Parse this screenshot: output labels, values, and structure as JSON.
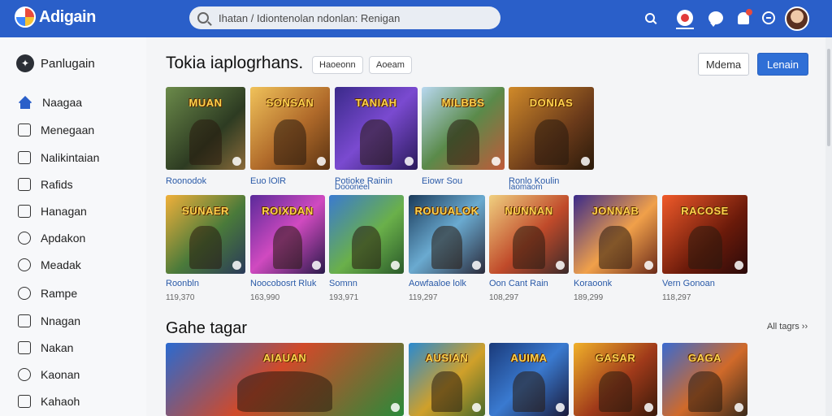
{
  "app": {
    "name": "Adigain"
  },
  "search": {
    "placeholder": "Ihatan / Idiontenolan ndonlan: Renigan"
  },
  "colors": {
    "topbar": "#2a5fc9",
    "accent": "#2f6fd6"
  },
  "topbar_icons": [
    "search-icon",
    "record-icon",
    "chat-icon",
    "notification-bell-icon",
    "apps-icon"
  ],
  "sidebar": {
    "header": "Panlugain",
    "items": [
      {
        "label": "Naagaa",
        "icon": "home-icon"
      },
      {
        "label": "Menegaan",
        "icon": "library-icon"
      },
      {
        "label": "Nalikintaian",
        "icon": "bookmark-icon"
      },
      {
        "label": "Rafids",
        "icon": "document-icon"
      },
      {
        "label": "Hanagan",
        "icon": "list-icon"
      },
      {
        "label": "Apdakon",
        "icon": "clock-icon"
      },
      {
        "label": "Meadak",
        "icon": "search-icon"
      },
      {
        "label": "Rampe",
        "icon": "timer-icon"
      },
      {
        "label": "Nnagan",
        "icon": "folder-icon"
      },
      {
        "label": "Nakan",
        "icon": "edit-icon"
      },
      {
        "label": "Kaonan",
        "icon": "settings-icon"
      },
      {
        "label": "Kahaoh",
        "icon": "media-icon"
      }
    ]
  },
  "main": {
    "title": "Tokia iaplogrhans.",
    "chips": [
      "Haoeonn",
      "Aoeam"
    ],
    "buttons": {
      "secondary": "Mdema",
      "primary": "Lenain"
    },
    "row1": [
      {
        "art": "MUAN",
        "label": "Roonodok",
        "label2": ""
      },
      {
        "art": "SONSAN",
        "label": "Euo lOlR",
        "label2": ""
      },
      {
        "art": "TANIAH",
        "label": "Potioke Rainin",
        "label2": "Doooneel"
      },
      {
        "art": "MILBBS",
        "label": "Eiowr Sou",
        "label2": ""
      },
      {
        "art": "DONIAS",
        "label": "Ronlo Koulin",
        "label2": "Iaomaom"
      }
    ],
    "row2": [
      {
        "art": "SUNAER",
        "label": "Roonbln",
        "count": "119,370"
      },
      {
        "art": "ROIXDAN",
        "label": "Noocobosrt Rluk",
        "count": "163,990"
      },
      {
        "art": "",
        "label": "Somnn",
        "count": "193,971"
      },
      {
        "art": "ROUUALOK",
        "label": "Aowfaaloe lolk",
        "count": "119,297"
      },
      {
        "art": "NUNNAN",
        "label": "Oon Cant Rain",
        "count": "108,297"
      },
      {
        "art": "JONNAB",
        "label": "Koraoonk",
        "count": "189,299"
      },
      {
        "art": "RACOSE",
        "label": "Vern Gonoan",
        "count": "118,297"
      }
    ],
    "section2": {
      "title": "Gahe tagar",
      "link": "All tagrs ››"
    },
    "row3": [
      {
        "art": "AIAUAN"
      },
      {
        "art": "AUSIAN"
      },
      {
        "art": "AUIMA"
      },
      {
        "art": "GASAR"
      },
      {
        "art": "GAGA"
      }
    ]
  }
}
